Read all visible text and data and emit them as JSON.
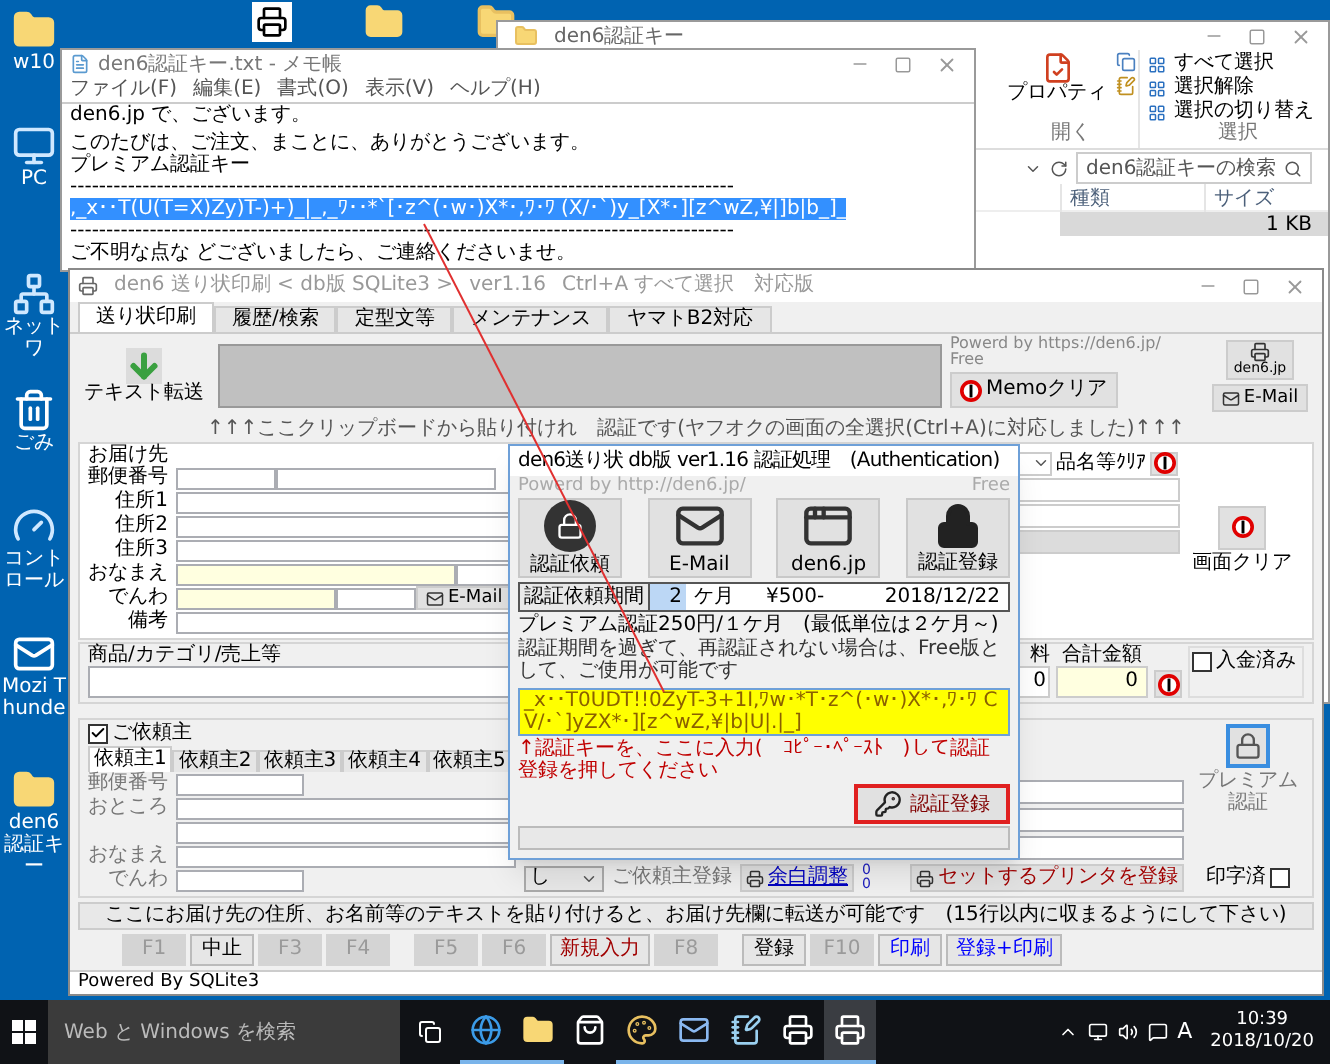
{
  "desktop": {
    "icons": [
      {
        "kind": "user-folder",
        "label": "w10"
      },
      {
        "kind": "pc",
        "label": "PC"
      },
      {
        "kind": "network",
        "label": "ネットワ"
      },
      {
        "kind": "recycle",
        "label": "ごみ"
      },
      {
        "kind": "control",
        "label": "コントロール"
      },
      {
        "kind": "mail",
        "label": "Mozi Thunde"
      },
      {
        "kind": "folder",
        "label": "den6認証キー"
      }
    ],
    "top_icons": [
      {
        "kind": "app"
      },
      {
        "kind": "folder"
      },
      {
        "kind": "zip"
      }
    ]
  },
  "explorer": {
    "title": "den6認証キー",
    "open_group": {
      "label": "開く",
      "items": [
        "プロパティ"
      ]
    },
    "select_group": {
      "label": "選択",
      "items": [
        "すべて選択",
        "選択解除",
        "選択の切り替え"
      ]
    },
    "search": {
      "placeholder": "den6認証キーの検索"
    },
    "columns": [
      "種類",
      "サイズ"
    ],
    "rows": [
      {
        "size": "1 KB",
        "selected": true
      }
    ]
  },
  "notepad": {
    "title": "den6認証キー.txt - メモ帳",
    "menu": [
      "ファイル(F)",
      "編集(E)",
      "書式(O)",
      "表示(V)",
      "ヘルプ(H)"
    ],
    "lines": [
      {
        "kind": "text",
        "text": "den6.jp で、ございます。",
        "selected": false
      },
      {
        "kind": "blank"
      },
      {
        "kind": "text",
        "text": "このたびは、ご注文、まことに、ありがとうございます。",
        "selected": false
      },
      {
        "kind": "text",
        "text": "プレミアム認証キー",
        "selected": false
      },
      {
        "kind": "text",
        "text": "--------------------------------------------------------------------------------------------",
        "selected": false
      },
      {
        "kind": "text",
        "text": ",_x･･T(U(T=X)Zy)T-)+)_|_,_ﾜ･･*`[･z^(･w･)X*･,ﾜ･ﾜ (X/･`)y_[X*･][z^wZ,¥|]b|b_]_",
        "selected": true
      },
      {
        "kind": "text",
        "text": "--------------------------------------------------------------------------------------------",
        "selected": false
      },
      {
        "kind": "text",
        "text": "ご不明な点な どございましたら、ご連絡くださいませ。",
        "selected": false
      }
    ]
  },
  "main": {
    "title": "den6 送り状印刷 < db版 SQLite3 >",
    "version": "ver1.16",
    "note": "Ctrl+A すべて選択　対応版",
    "tabs": [
      {
        "label": "送り状印刷",
        "selected": true
      },
      {
        "label": "履歴/検索",
        "selected": false
      },
      {
        "label": "定型文等",
        "selected": false
      },
      {
        "label": "メンテナンス",
        "selected": false
      },
      {
        "label": "ヤマトB2対応",
        "selected": false
      }
    ],
    "transfer_button": "テキスト転送",
    "powered": "Powerd by https://den6.jp/",
    "edition": "Free",
    "memo_clear_button": "Memoクリア",
    "site_button": "den6.jp",
    "email_button": "E-Mail",
    "hint": "↑↑↑ここクリップボードから貼り付けれ　認証です(ヤフオクの画面の全選択(Ctrl+A)に対応しました)↑↑↑",
    "recipient": {
      "title": "お届け先",
      "fields": [
        {
          "kind": "zip",
          "label": "郵便番号"
        },
        {
          "kind": "wide",
          "label": "住所1"
        },
        {
          "kind": "wide",
          "label": "住所2"
        },
        {
          "kind": "wide",
          "label": "住所3"
        },
        {
          "kind": "name",
          "label": "おなまえ"
        },
        {
          "kind": "phone",
          "label": "でんわ"
        },
        {
          "kind": "wide",
          "label": "備考"
        }
      ],
      "email_button": "E-Mail",
      "item_clear": "品名等ｸﾘｱ",
      "screen_clear_button": "画面クリア"
    },
    "goods": {
      "title": "商品/カテゴリ/売上等",
      "fee_label": "料",
      "fee": "0",
      "total_label": "合計金額",
      "total": "0",
      "paid": {
        "label": "入金済み",
        "checked": false
      }
    },
    "sender": {
      "enabled": {
        "label": "ご依頼主",
        "checked": true
      },
      "tabs": [
        {
          "label": "依頼主1",
          "selected": true
        },
        {
          "label": "依頼主2",
          "selected": false
        },
        {
          "label": "依頼主3",
          "selected": false
        },
        {
          "label": "依頼主4",
          "selected": false
        },
        {
          "label": "依頼主5",
          "selected": false
        }
      ],
      "fields": [
        {
          "kind": "zip",
          "label": "郵便番号"
        },
        {
          "kind": "wide",
          "label": "おところ"
        },
        {
          "kind": "wide"
        },
        {
          "kind": "wide",
          "label": "おなまえ"
        },
        {
          "kind": "zip",
          "label": "でんわ"
        }
      ],
      "dropdown": "し",
      "register_label": "ご依頼主登録",
      "margin_button": "余白調整",
      "margins": [
        "0",
        "0"
      ],
      "printer_button": "セットするプリンタを登録",
      "premium_button": "プレミアム認証",
      "printed": {
        "label": "印字済",
        "checked": false
      }
    },
    "footer_hint": "ここにお届け先の住所、お名前等のテキストを貼り付けると、お届け先欄に転送が可能です　(15行以内に収まるようにして下さい)",
    "function_keys": [
      {
        "label": "F1",
        "disabled": true
      },
      {
        "label": "中止",
        "disabled": false,
        "color": "#000000"
      },
      {
        "label": "F3",
        "disabled": true
      },
      {
        "label": "F4",
        "disabled": true
      },
      {
        "label": "F5",
        "disabled": true
      },
      {
        "label": "F6",
        "disabled": true
      },
      {
        "label": "新規入力",
        "disabled": false,
        "color": "#a00000"
      },
      {
        "label": "F8",
        "disabled": true
      },
      {
        "label": "登録",
        "disabled": false,
        "color": "#000000"
      },
      {
        "label": "F10",
        "disabled": true
      },
      {
        "label": "印刷",
        "disabled": false,
        "color": "#0000ff"
      },
      {
        "label": "登録+印刷",
        "disabled": false,
        "color": "#0000ff"
      }
    ],
    "status": "Powered By SQLite3"
  },
  "dialog": {
    "title": "den6送り状 db版 ver1.16 認証処理　(Authentication)",
    "powered": "Powerd by http://den6.jp/",
    "edition": "Free",
    "actions": [
      {
        "kind": "lock",
        "label": "認証依頼"
      },
      {
        "kind": "mail",
        "label": "E-Mail"
      },
      {
        "kind": "web",
        "label": "den6.jp"
      },
      {
        "kind": "key",
        "label": "認証登録"
      }
    ],
    "period_label": "認証依頼期間",
    "period": "2",
    "period_unit": "ケ月",
    "price": "¥500-",
    "expiry": "2018/12/22",
    "premium_note": "プレミアム認証250円/１ケ月　(最低単位は２ケ月～)",
    "free_note": "認証期間を過ぎて、再認証されない場合は、Free版として、ご使用が可能です",
    "key_value": "_x･･T0UDT!!0ZyT-3+1I,ﾜw･*T･z^(･w･)X*･,ﾜ･ﾜ   CV/･`]yZX*･][z^wZ,¥|b|U|.|_]",
    "instruction": "↑認証キーを、ここに入力(　ｺﾋﾟｰ･ﾍﾟｰｽﾄ　)して認証登録を押してください",
    "register_button": "認証登録"
  },
  "taskbar": {
    "search_placeholder": "Web と Windows を検索",
    "apps": [
      {
        "kind": "browser",
        "running": true,
        "selected": false
      },
      {
        "kind": "folder",
        "running": true,
        "selected": false
      },
      {
        "kind": "store",
        "running": false,
        "selected": false
      },
      {
        "kind": "paint",
        "running": true,
        "selected": false
      },
      {
        "kind": "mail",
        "running": true,
        "selected": false
      },
      {
        "kind": "notepad",
        "running": true,
        "selected": false
      },
      {
        "kind": "printer",
        "running": true,
        "selected": false
      },
      {
        "kind": "printer",
        "running": true,
        "selected": true
      }
    ],
    "ime": "A",
    "time": "10:39",
    "date": "2018/10/20"
  }
}
